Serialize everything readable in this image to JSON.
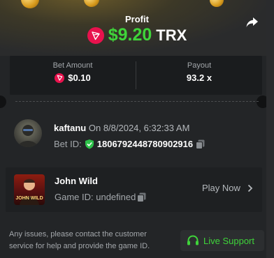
{
  "header": {
    "title": "Profit",
    "profit_amount": "$9.20",
    "currency": "TRX"
  },
  "stats": {
    "bet_amount_label": "Bet Amount",
    "bet_amount_value": "$0.10",
    "payout_label": "Payout",
    "payout_value": "93.2 x"
  },
  "user": {
    "username": "kaftanu",
    "date_text": "On 8/8/2024, 6:32:33 AM",
    "bet_id_label": "Bet ID:",
    "bet_id_value": "1806792448780902916"
  },
  "game": {
    "name": "John Wild",
    "thumb_text": "JOHN WILD",
    "game_id_label": "Game ID: undefined",
    "play_now_label": "Play Now"
  },
  "footer": {
    "help_text": "Any issues, please contact the customer service for help and provide the game ID.",
    "live_support_label": "Live Support"
  },
  "colors": {
    "profit_green": "#3fd43a",
    "trx_red": "#e8124d"
  }
}
